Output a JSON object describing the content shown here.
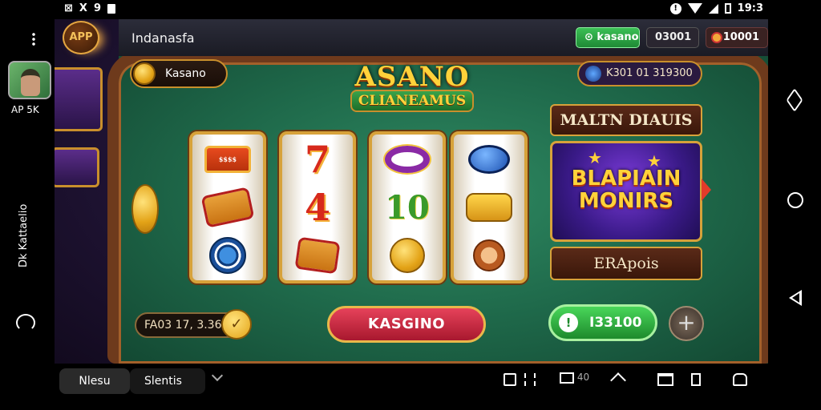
{
  "status_bar": {
    "left_icons": [
      "x-box-icon",
      "tilde-x-icon",
      "nine-icon",
      "notification-icon"
    ],
    "left_text": [
      "X",
      "9"
    ],
    "time": "19:3",
    "battery_icon": "battery-icon"
  },
  "left_rail": {
    "menu_icon": "kebab-menu-icon",
    "app_label": "AP 5K",
    "vertical_label": "Dk Kattaelio"
  },
  "top_bar": {
    "app_badge": "APP",
    "title": "Indanasfa",
    "green_pill": "kasano",
    "mid_pill": "03001",
    "coins_pill": "10001"
  },
  "game": {
    "player_chip": "Kasano",
    "logo_top": "ASANO",
    "logo_bottom": "CLIANEAMUS",
    "jackpot_display": "K301 01 319300",
    "malt_button": "MALTN DIAUIS",
    "promo_line1": "BLAPIAIN",
    "promo_line2": "MONIRS",
    "eraps_button": "ERApois",
    "balance": "FA03 17, 3.36",
    "spin_button": "KASGINO",
    "win_amount": "I33100",
    "plus_button": "+",
    "reel_symbols": {
      "reel1": [
        "treasure-chest-icon",
        "card-icon",
        "chip-icon"
      ],
      "reel2": [
        "7",
        "4",
        "card-icon"
      ],
      "reel3": [
        "ring-icon",
        "10",
        "coin-icon"
      ],
      "reel4": [
        "gem-icon",
        "wallet-icon",
        "tiger-icon"
      ]
    }
  },
  "bottom_bar": {
    "tab1": "Nlesu",
    "tab2": "Slentis",
    "icons": [
      "camera-icon",
      "collapse-icon",
      "capture-icon",
      "up-chevron-icon",
      "window-icon",
      "page-icon",
      "car-icon"
    ],
    "capture_text": "40"
  },
  "colors": {
    "felt": "#1f6a4b",
    "gold": "#d7a23a",
    "spin_red": "#c8243c",
    "win_green": "#2aa83a"
  }
}
